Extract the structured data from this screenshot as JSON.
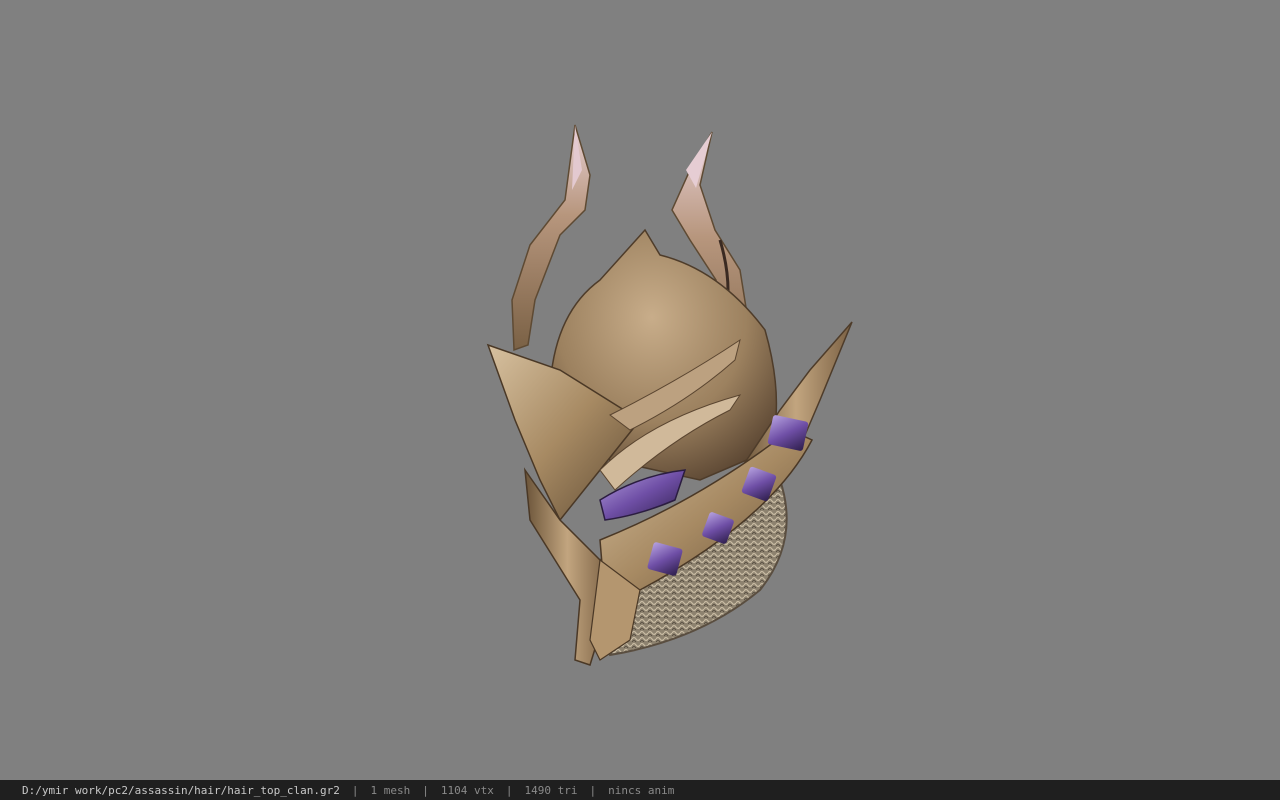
{
  "viewer": {
    "background_color": "#808080",
    "model": {
      "description_icon": "helmet-model",
      "accent_colors": {
        "metal_light": "#c9ae8c",
        "metal_mid": "#a3865f",
        "metal_dark": "#5b4630",
        "gem_purple": "#8b6fc0",
        "mail": "#a79a86"
      }
    }
  },
  "statusbar": {
    "file_path": "D:/ymir work/pc2/assassin/hair/hair_top_clan.gr2",
    "separator": "|",
    "mesh_count": "1 mesh",
    "vertex_count": "1104 vtx",
    "triangle_count": "1490 tri",
    "anim_status": "nincs anim"
  }
}
